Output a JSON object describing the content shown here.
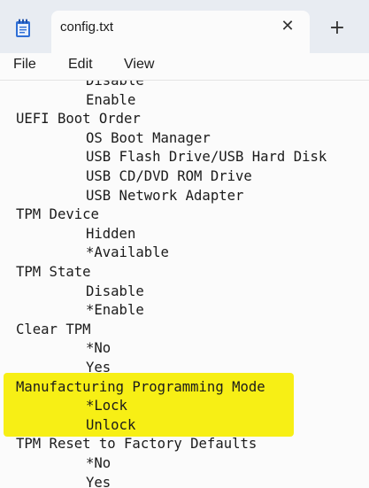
{
  "window": {
    "tab_title": "config.txt",
    "close_glyph": "✕",
    "new_tab_glyph": "+"
  },
  "menu": {
    "file": "File",
    "edit": "Edit",
    "view": "View"
  },
  "editor": {
    "lines": [
      {
        "indent": 1,
        "text": "Disable"
      },
      {
        "indent": 1,
        "text": "Enable"
      },
      {
        "indent": 0,
        "text": "UEFI Boot Order"
      },
      {
        "indent": 1,
        "text": "OS Boot Manager"
      },
      {
        "indent": 1,
        "text": "USB Flash Drive/USB Hard Disk"
      },
      {
        "indent": 1,
        "text": "USB CD/DVD ROM Drive"
      },
      {
        "indent": 1,
        "text": "USB Network Adapter"
      },
      {
        "indent": 0,
        "text": "TPM Device"
      },
      {
        "indent": 1,
        "text": "Hidden"
      },
      {
        "indent": 1,
        "text": "*Available"
      },
      {
        "indent": 0,
        "text": "TPM State"
      },
      {
        "indent": 1,
        "text": "Disable"
      },
      {
        "indent": 1,
        "text": "*Enable"
      },
      {
        "indent": 0,
        "text": "Clear TPM"
      },
      {
        "indent": 1,
        "text": "*No"
      },
      {
        "indent": 1,
        "text": "Yes"
      },
      {
        "indent": 0,
        "text": "Manufacturing Programming Mode"
      },
      {
        "indent": 1,
        "text": "*Lock"
      },
      {
        "indent": 1,
        "text": "Unlock"
      },
      {
        "indent": 0,
        "text": "TPM Reset to Factory Defaults"
      },
      {
        "indent": 1,
        "text": "*No"
      },
      {
        "indent": 1,
        "text": "Yes"
      }
    ],
    "highlight_color": "#f7ef15"
  }
}
